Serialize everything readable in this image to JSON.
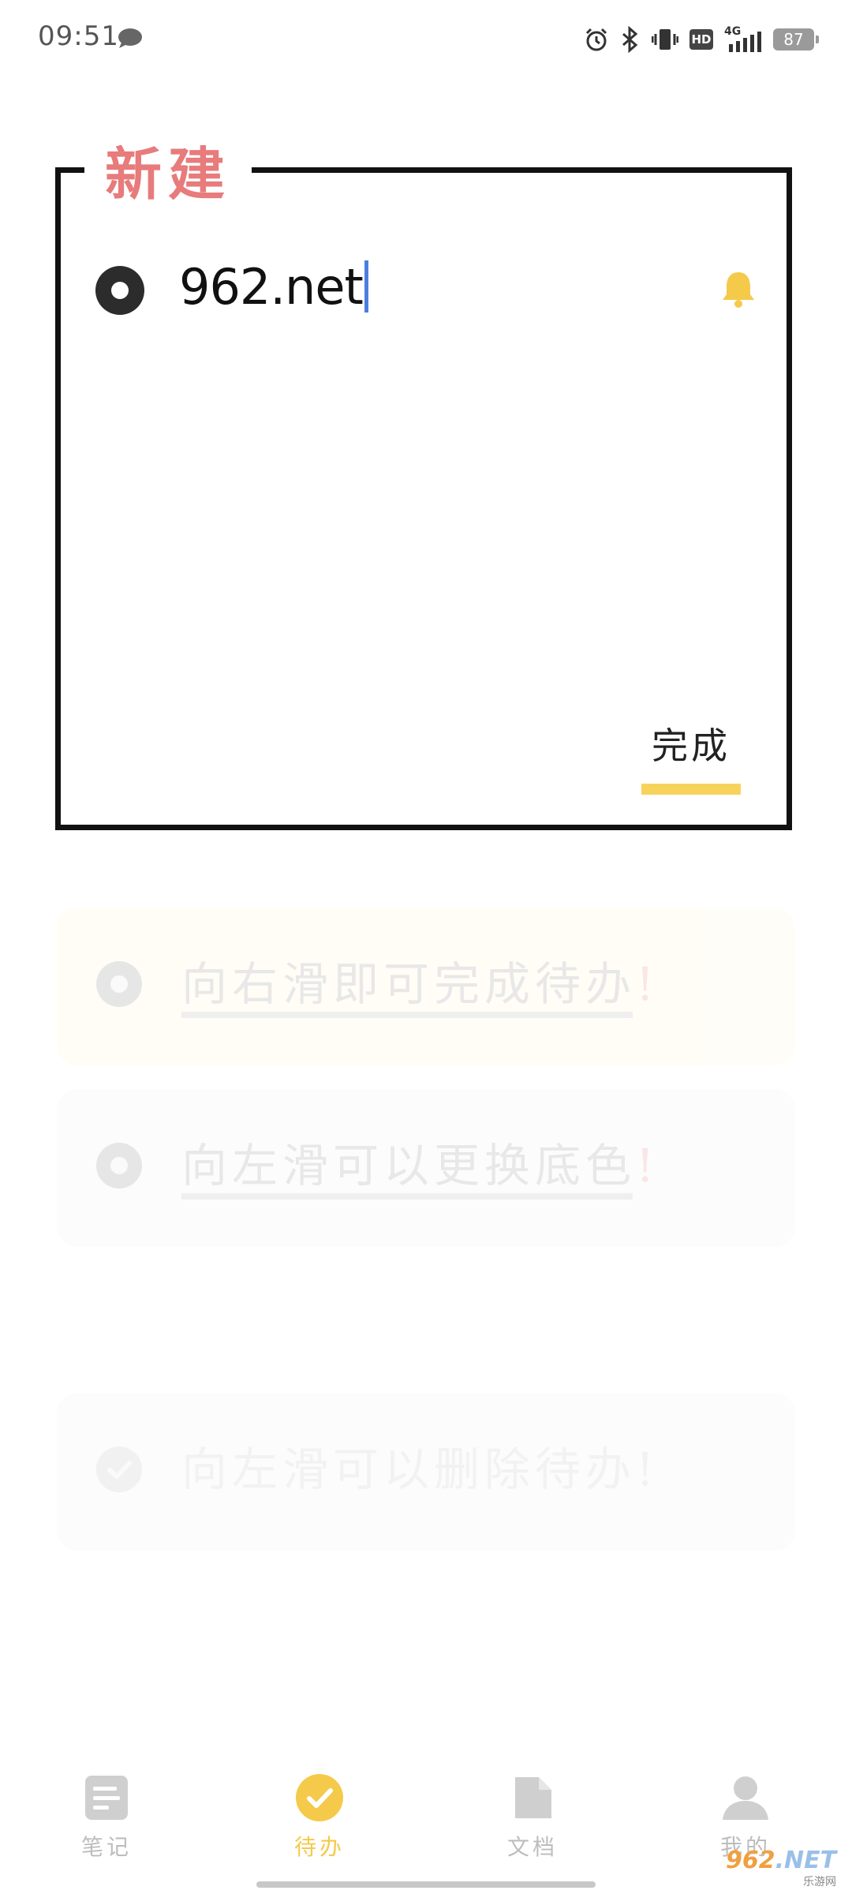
{
  "status_bar": {
    "time": "09:51",
    "battery": "87",
    "network": "4G",
    "hd": "HD"
  },
  "new_card": {
    "title": "新建",
    "input_value": "962.net",
    "done_label": "完成"
  },
  "hints": [
    {
      "text": "向右滑即可完成待办",
      "mark": "!"
    },
    {
      "text": "向左滑可以更换底色",
      "mark": "!"
    },
    {
      "text": "向左滑可以删除待办!"
    }
  ],
  "nav": {
    "items": [
      {
        "label": "笔记",
        "icon": "note-icon"
      },
      {
        "label": "待办",
        "icon": "check-circle-icon"
      },
      {
        "label": "文档",
        "icon": "document-icon"
      },
      {
        "label": "我的",
        "icon": "user-icon"
      }
    ],
    "active_index": 1
  },
  "watermark": {
    "main_a": "962",
    "main_b": ".NET",
    "sub": "乐游网"
  },
  "colors": {
    "accent_yellow": "#f7d35c",
    "title_red": "#e87b7b",
    "caret_blue": "#4a7fe0",
    "bell_yellow": "#f5c94a"
  }
}
